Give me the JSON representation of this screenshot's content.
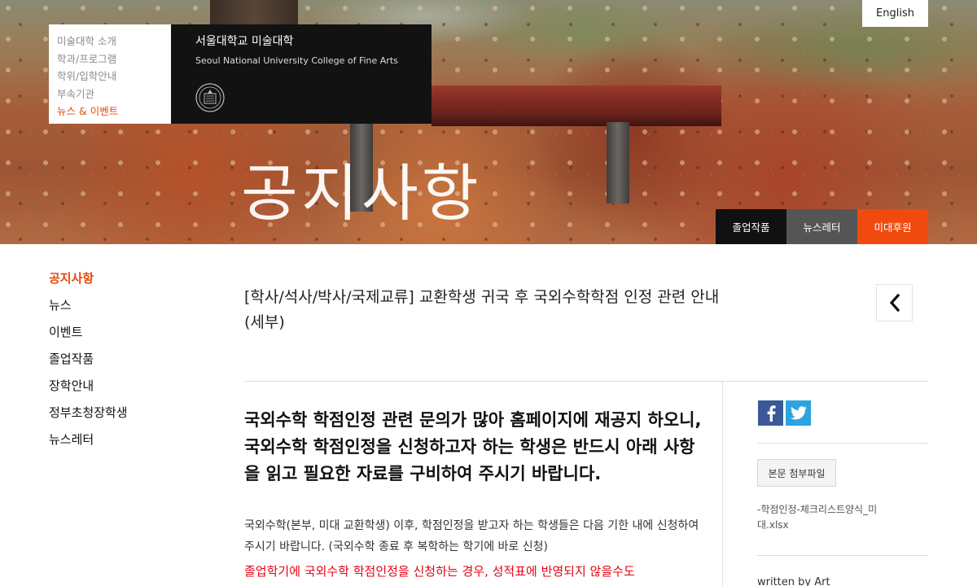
{
  "header": {
    "language_button": "English",
    "menu": [
      {
        "label": "미술대학 소개",
        "active": false
      },
      {
        "label": "학과/프로그램",
        "active": false
      },
      {
        "label": "학위/입학안내",
        "active": false
      },
      {
        "label": "부속기관",
        "active": false
      },
      {
        "label": "뉴스 & 이벤트",
        "active": true
      }
    ],
    "brand_ko": "서울대학교 미술대학",
    "brand_en": "Seoul National University College of Fine Arts",
    "hero_title": "공지사항",
    "quick_links": [
      "졸업작품",
      "뉴스레터",
      "미대후원"
    ]
  },
  "sidebar": {
    "items": [
      {
        "label": "공지사항",
        "active": true
      },
      {
        "label": "뉴스",
        "active": false
      },
      {
        "label": "이벤트",
        "active": false
      },
      {
        "label": "졸업작품",
        "active": false
      },
      {
        "label": "장학안내",
        "active": false
      },
      {
        "label": "정부초청장학생",
        "active": false
      },
      {
        "label": "뉴스레터",
        "active": false
      }
    ]
  },
  "article": {
    "title": "[학사/석사/박사/국제교류] 교환학생 귀국 후 국외수학학점 인정 관련 안내(세부)",
    "lead": "국외수학 학점인정 관련 문의가 많아 홈페이지에 재공지 하오니, 국외수학 학점인정을 신청하고자 하는 학생은 반드시 아래 사항을 읽고 필요한 자료를 구비하여 주시기 바랍니다.",
    "body": "국외수학(본부, 미대 교환학생) 이후, 학점인정을 받고자 하는 학생들은 다음 기한 내에 신청하여 주시기 바랍니다. (국외수학 종료 후 복학하는 학기에 바로 신청)",
    "body_red": "졸업학기에 국외수학 학점인정을 신청하는 경우, 성적표에 반영되지 않을수도"
  },
  "aside": {
    "sns": [
      "facebook-icon",
      "twitter-icon"
    ],
    "attach_label": "본문 첨부파일",
    "attach_file": "-학점인정-체크리스트양식_미대.xlsx",
    "writer": "written by Art"
  },
  "colors": {
    "accent": "#e8480c",
    "quick_dark": "#111111",
    "quick_gray": "#555555",
    "quick_orange": "#f04a0e",
    "facebook": "#3b5998",
    "twitter": "#2ba4e0",
    "notice_red": "#e60012"
  }
}
